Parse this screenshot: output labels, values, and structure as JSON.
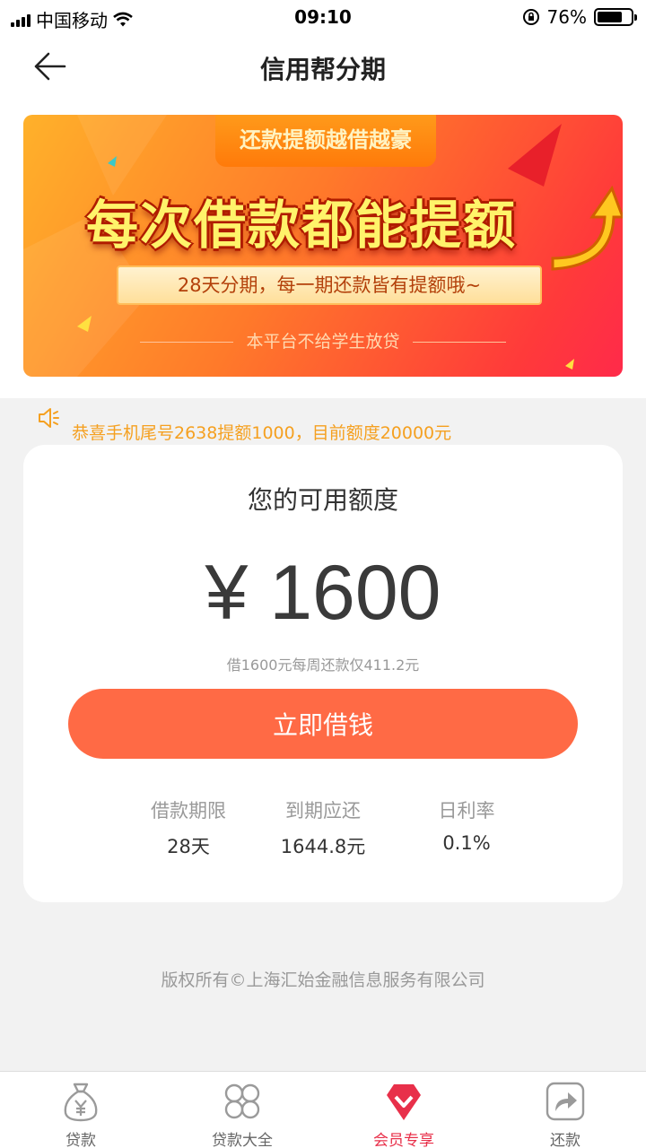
{
  "status_bar": {
    "carrier": "中国移动",
    "time": "09:10",
    "battery": "76%",
    "battery_level": 0.76
  },
  "nav": {
    "title": "信用帮分期"
  },
  "banner": {
    "tag": "还款提额越借越豪",
    "headline": "每次借款都能提额",
    "ribbon": "28天分期，每一期还款皆有提额哦~",
    "note": "本平台不给学生放贷"
  },
  "notice": {
    "text": "恭喜手机尾号2638提额1000，目前额度20000元"
  },
  "credit": {
    "title": "您的可用额度",
    "amount": "¥ 1600",
    "subtitle": "借1600元每周还款仅411.2元",
    "button": "立即借钱",
    "stats": [
      {
        "label": "借款期限",
        "value": "28天"
      },
      {
        "label": "到期应还",
        "value": "1644.8元"
      },
      {
        "label": "日利率",
        "value": "0.1%"
      }
    ]
  },
  "footer": {
    "copyright": "版权所有©上海汇始金融信息服务有限公司"
  },
  "tabs": [
    {
      "label": "贷款",
      "icon": "money-bag-icon",
      "active": false
    },
    {
      "label": "贷款大全",
      "icon": "grid-icon",
      "active": false
    },
    {
      "label": "会员专享",
      "icon": "diamond-icon",
      "active": true
    },
    {
      "label": "还款",
      "icon": "share-arrow-icon",
      "active": false
    }
  ],
  "colors": {
    "accent": "#ff6a45",
    "active_tab": "#e8304a",
    "notice": "#f5a020"
  }
}
